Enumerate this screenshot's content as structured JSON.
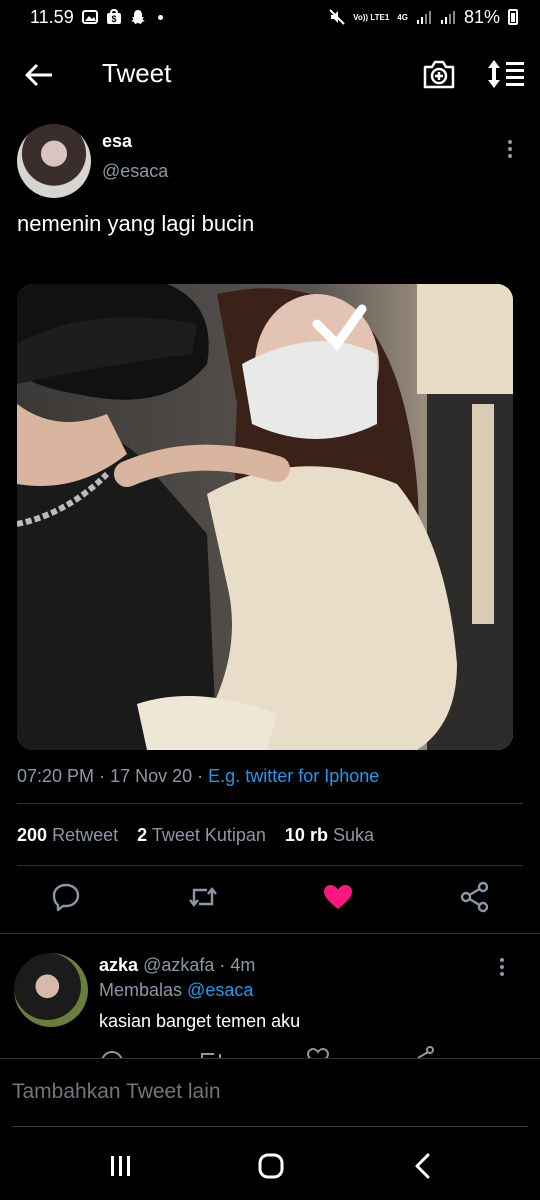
{
  "status_bar": {
    "time": "11.59",
    "network": "4G",
    "volte": "Vo)) LTE1",
    "battery": "81%"
  },
  "header": {
    "title": "Tweet",
    "icons": [
      "back-arrow-icon",
      "camera-plus-icon",
      "sort-icon"
    ]
  },
  "tweet": {
    "author_name": "esa",
    "author_handle": "@esaca",
    "text": "nemenin yang lagi bucin",
    "photo_icon": "photo-image",
    "time": "07:20 PM",
    "date": "17 Nov 20",
    "separator": "·",
    "client": "E.g. twitter for Iphone",
    "stats": {
      "retweets_count": "200",
      "retweets_label": "Retweet",
      "quotes_count": "2",
      "quotes_label": "Tweet Kutipan",
      "likes_count": "10 rb",
      "likes_label": "Suka"
    },
    "actions": [
      "reply-icon",
      "retweet-icon",
      "like-icon",
      "share-icon"
    ],
    "liked": true
  },
  "reply": {
    "author_name": "azka",
    "author_handle": "@azkafa",
    "time": "· 4m",
    "replying_label": "Membalas",
    "replying_to": "@esaca",
    "text": "kasian banget temen aku"
  },
  "compose": {
    "placeholder": "Tambahkan Tweet lain"
  },
  "colors": {
    "background": "#000000",
    "accent": "#1d9bf0",
    "like": "#f91880",
    "secondary_text": "#8b98a5",
    "divider": "#2f3336"
  },
  "navbar": {
    "icons": [
      "recent-apps-icon",
      "home-icon",
      "back-icon"
    ]
  }
}
